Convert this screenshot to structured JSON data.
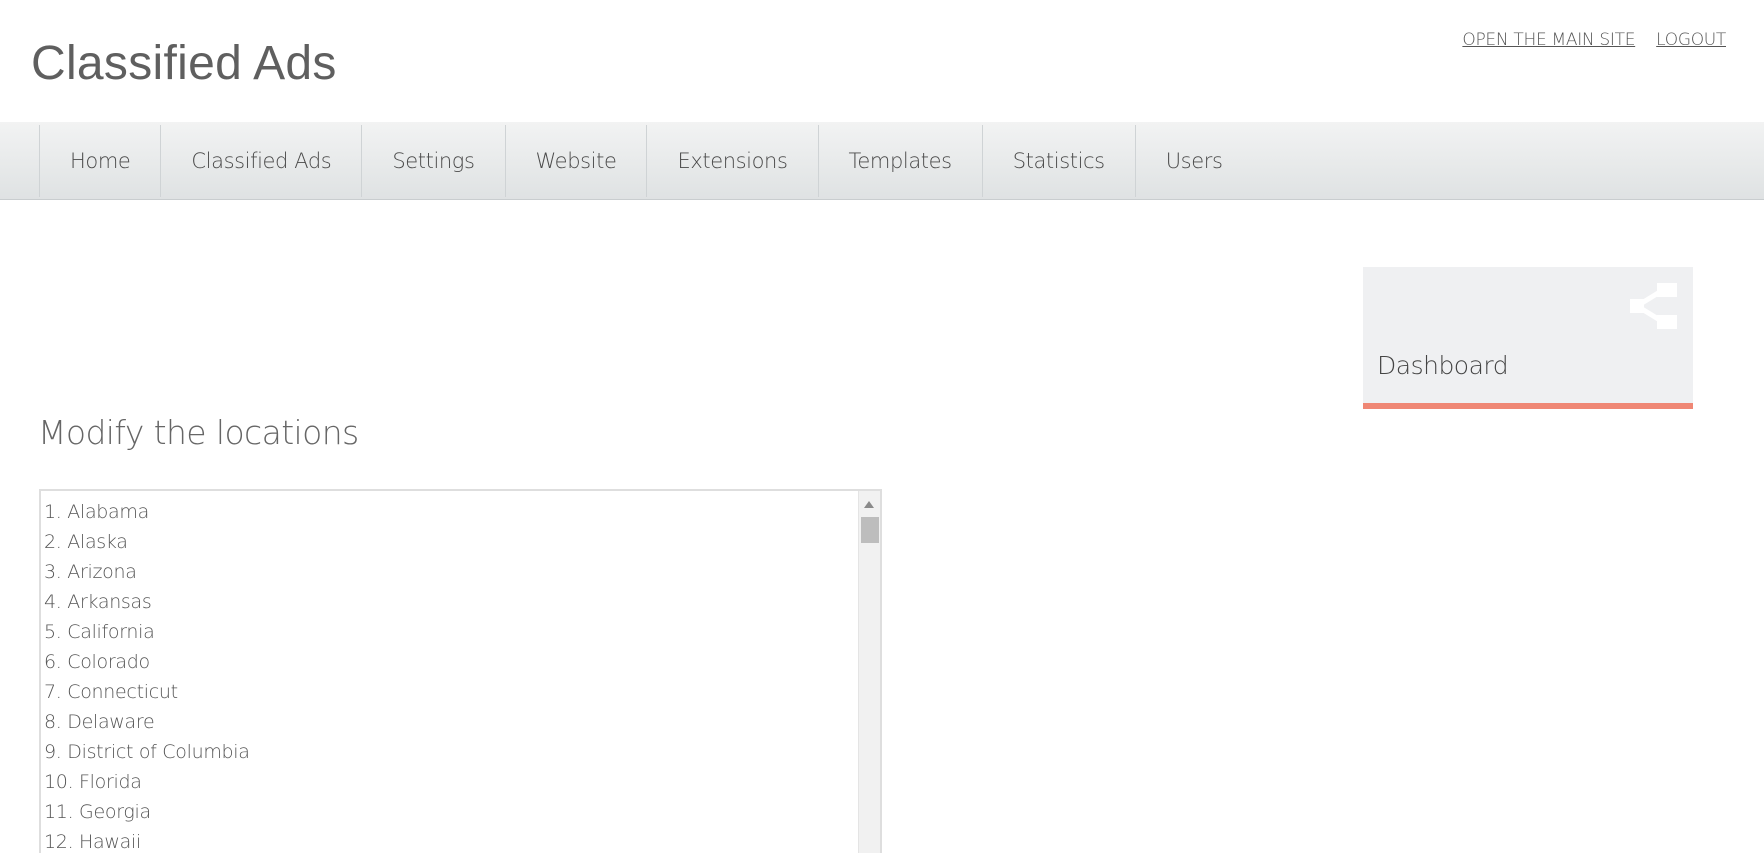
{
  "header": {
    "title": "Classified Ads",
    "links": [
      "OPEN THE MAIN SITE",
      "LOGOUT"
    ]
  },
  "nav": {
    "items": [
      "Home",
      "Classified Ads",
      "Settings",
      "Website",
      "Extensions",
      "Templates",
      "Statistics",
      "Users"
    ]
  },
  "dashboard": {
    "label": "Dashboard",
    "icon": "share-icon",
    "accent_color": "#ef8775"
  },
  "main": {
    "title": "Modify the locations",
    "locations": [
      "1. Alabama",
      "2. Alaska",
      "3. Arizona",
      "4. Arkansas",
      "5. California",
      "6. Colorado",
      "7. Connecticut",
      "8. Delaware",
      "9. District of Columbia",
      "10. Florida",
      "11. Georgia",
      "12. Hawaii"
    ]
  }
}
